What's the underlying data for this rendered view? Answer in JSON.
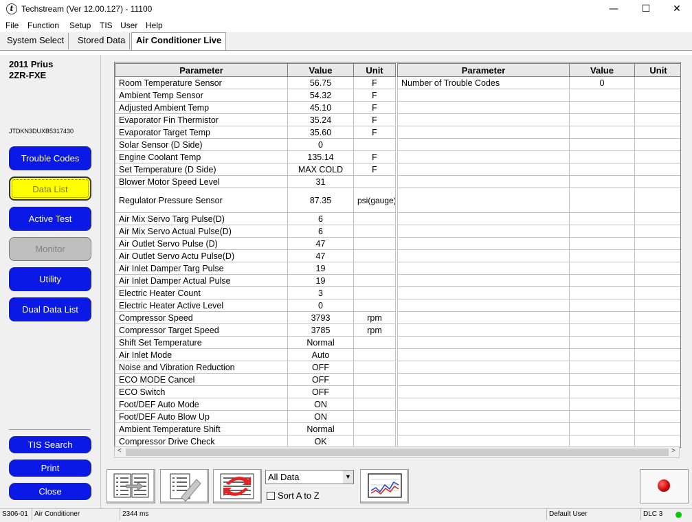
{
  "window": {
    "title": "Techstream (Ver 12.00.127) - 11100",
    "app_icon": "t",
    "minimize": "—",
    "maximize": "☐",
    "close": "✕"
  },
  "menu": [
    "File",
    "Function",
    "Setup",
    "TIS",
    "User",
    "Help"
  ],
  "tabs": [
    {
      "label": "System Select",
      "active": false
    },
    {
      "label": "Stored Data",
      "active": false
    },
    {
      "label": "Air Conditioner Live",
      "active": true
    }
  ],
  "vehicle": {
    "model": "2011 Prius",
    "engine": "2ZR-FXE",
    "vin": "JTDKN3DUXB5317430"
  },
  "sidebar": {
    "buttons": [
      {
        "label": "Trouble Codes",
        "state": "normal"
      },
      {
        "label": "Data List",
        "state": "selected"
      },
      {
        "label": "Active Test",
        "state": "normal"
      },
      {
        "label": "Monitor",
        "state": "disabled"
      },
      {
        "label": "Utility",
        "state": "normal"
      },
      {
        "label": "Dual Data List",
        "state": "normal"
      }
    ],
    "bottom_buttons": [
      "TIS Search",
      "Print",
      "Close"
    ]
  },
  "grid_left": {
    "headers": [
      "Parameter",
      "Value",
      "Unit"
    ],
    "rows": [
      [
        "Room Temperature Sensor",
        "56.75",
        "F"
      ],
      [
        "Ambient Temp Sensor",
        "54.32",
        "F"
      ],
      [
        "Adjusted Ambient Temp",
        "45.10",
        "F"
      ],
      [
        "Evaporator Fin Thermistor",
        "35.24",
        "F"
      ],
      [
        "Evaporator Target Temp",
        "35.60",
        "F"
      ],
      [
        "Solar Sensor (D Side)",
        "0",
        ""
      ],
      [
        "Engine Coolant Temp",
        "135.14",
        "F"
      ],
      [
        "Set Temperature (D Side)",
        "MAX COLD",
        "F"
      ],
      [
        "Blower Motor Speed Level",
        "31",
        ""
      ],
      [
        "Regulator Pressure Sensor",
        "87.35",
        "psi(gauge)"
      ],
      [
        "Air Mix Servo Targ Pulse(D)",
        "6",
        ""
      ],
      [
        "Air Mix Servo Actual Pulse(D)",
        "6",
        ""
      ],
      [
        "Air Outlet Servo Pulse (D)",
        "47",
        ""
      ],
      [
        "Air Outlet Servo Actu Pulse(D)",
        "47",
        ""
      ],
      [
        "Air Inlet Damper Targ Pulse",
        "19",
        ""
      ],
      [
        "Air Inlet Damper Actual Pulse",
        "19",
        ""
      ],
      [
        "Electric Heater Count",
        "3",
        ""
      ],
      [
        "Electric Heater Active Level",
        "0",
        ""
      ],
      [
        "Compressor Speed",
        "3793",
        "rpm"
      ],
      [
        "Compressor Target Speed",
        "3785",
        "rpm"
      ],
      [
        "Shift Set Temperature",
        "Normal",
        ""
      ],
      [
        "Air Inlet Mode",
        "Auto",
        ""
      ],
      [
        "Noise and Vibration Reduction",
        "OFF",
        ""
      ],
      [
        "ECO MODE Cancel",
        "OFF",
        ""
      ],
      [
        "ECO Switch",
        "OFF",
        ""
      ],
      [
        "Foot/DEF Auto Mode",
        "ON",
        ""
      ],
      [
        "Foot/DEF Auto Blow Up",
        "ON",
        ""
      ],
      [
        "Ambient Temperature Shift",
        "Normal",
        ""
      ],
      [
        "Compressor Drive Check",
        "OK",
        ""
      ]
    ]
  },
  "grid_right": {
    "headers": [
      "Parameter",
      "Value",
      "Unit"
    ],
    "rows": [
      [
        "Number of Trouble Codes",
        "0",
        ""
      ]
    ]
  },
  "scroll": {
    "left_arrow": "<",
    "right_arrow": ">"
  },
  "toolbar": {
    "view_select": "All Data",
    "view_select_arrow": "▼",
    "sort_label": "Sort A to Z",
    "sort_checked": false
  },
  "status": {
    "code": "S306-01",
    "system": "Air Conditioner",
    "timing": "2344 ms",
    "user": "Default User",
    "connector": "DLC 3",
    "connector_led_color": "#00cc00"
  },
  "colors": {
    "button_blue": "#0a19e6",
    "selected_yellow": "#ffff00",
    "record_red": "#cc0000"
  }
}
